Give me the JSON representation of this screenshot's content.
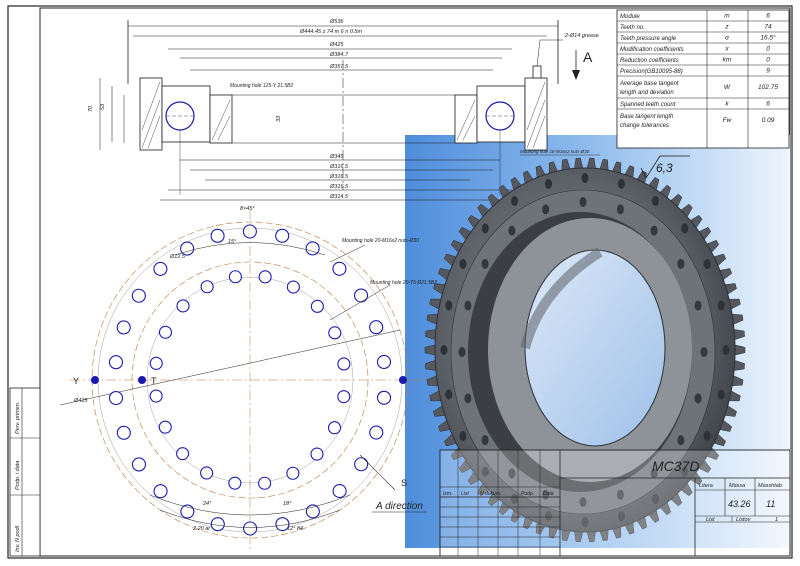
{
  "params": {
    "rows": [
      {
        "name": "Module",
        "symbol": "m",
        "value": "6"
      },
      {
        "name": "Teeth no.",
        "symbol": "z",
        "value": "74"
      },
      {
        "name": "Teeth pressure angle",
        "symbol": "α",
        "value": "16.5°"
      },
      {
        "name": "Modification coefficients",
        "symbol": "x",
        "value": "0"
      },
      {
        "name": "Reduction coefficients",
        "symbol": "km",
        "value": "0"
      },
      {
        "name": "Precision(GB10095-88)",
        "symbol": "",
        "value": "9"
      },
      {
        "name": "Average base tangent length and deviation",
        "symbol": "W",
        "value": "102.75"
      },
      {
        "name": "Spanned teeth count",
        "symbol": "k",
        "value": "6"
      },
      {
        "name": "Base tangent length change tolerances",
        "symbol": "Fw",
        "value": "0.09"
      }
    ]
  },
  "title_block": {
    "drawing_name": "MC37D",
    "col_headers": [
      "Litera",
      "Massa",
      "Masshtab"
    ],
    "mass": "43.26",
    "scale": "11",
    "sheet_label": "List",
    "sheets_label": "Listov",
    "sheets_count": "1",
    "rev_headers": [
      "Izm.",
      "List",
      "N dokum.",
      "Podp.",
      "Data"
    ]
  },
  "side_stamp": [
    "Perv. primen.",
    "Podp. i data",
    "Inv. N podl."
  ],
  "surface_finish": "6,3",
  "view_arrow": "A",
  "labels": {
    "direction": "A direction",
    "point_y": "Y",
    "point_t": "T",
    "point_s": "S",
    "mounting_top": "Mounting hole 125-Y 21.5B2",
    "mounting_holes_1": "Mounting hole 20-M16x2 nuts-Ø30",
    "mounting_holes_2": "Mounting hole 20-T5 Ø21.5B2",
    "mounting_right": "Mounting hole 18-M16x2 nuts-Ø30",
    "grease": "2-Ø14 grease"
  }
}
